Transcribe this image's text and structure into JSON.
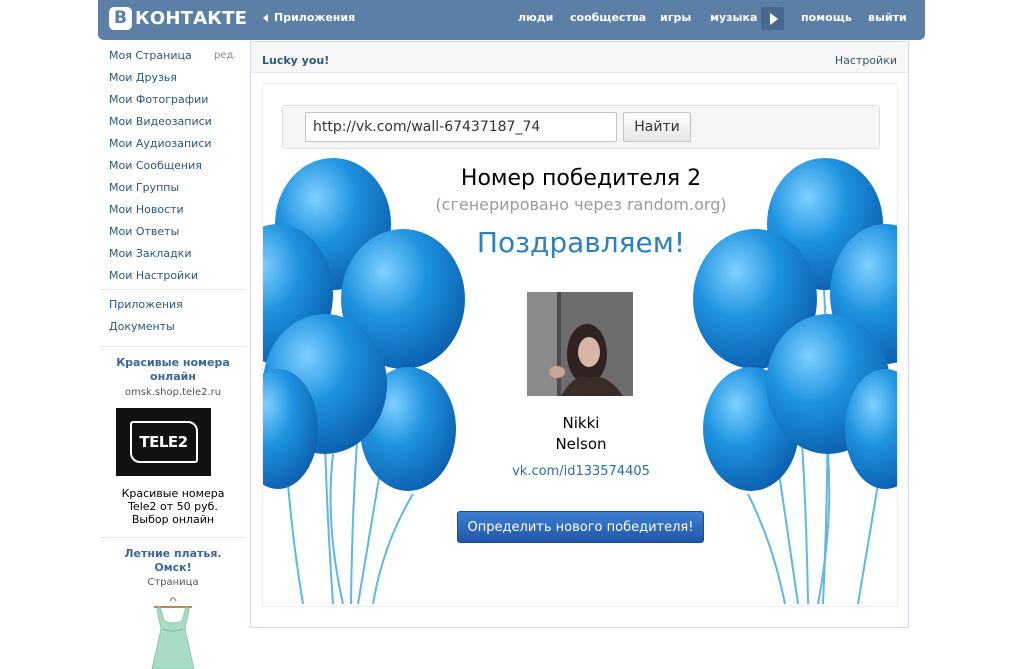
{
  "header": {
    "logo_mark": "В",
    "logo_text": "КОНТАКТЕ",
    "apps_link": "Приложения",
    "nav": [
      "люди",
      "сообщества",
      "игры",
      "музыка",
      "помощь",
      "выйти"
    ]
  },
  "sidebar": {
    "menu": [
      "Моя Страница",
      "Мои Друзья",
      "Мои Фотографии",
      "Мои Видеозаписи",
      "Мои Аудиозаписи",
      "Мои Сообщения",
      "Мои Группы",
      "Мои Новости",
      "Мои Ответы",
      "Мои Закладки",
      "Мои Настройки"
    ],
    "edit_label": "ред.",
    "menu2": [
      "Приложения",
      "Документы"
    ],
    "ad1": {
      "title_line1": "Красивые номера",
      "title_line2": "онлайн",
      "url": "omsk.shop.tele2.ru",
      "logo_text": "TELE2",
      "text_line1": "Красивые номера",
      "text_line2": "Tele2 от 50 руб.",
      "text_line3": "Выбор онлайн"
    },
    "ad2": {
      "title_line1": "Летние платья.",
      "title_line2": "Омск!",
      "subtitle": "Страница"
    }
  },
  "app": {
    "title": "Lucky you!",
    "settings": "Настройки",
    "url_value": "http://vk.com/wall-67437187_74",
    "find_button": "Найти",
    "winner_heading": "Номер победителя 2",
    "generated_note": "(сгенерировано через random.org)",
    "congrats": "Поздравляем!",
    "winner_first_name": "Nikki",
    "winner_last_name": "Nelson",
    "winner_link": "vk.com/id133574405",
    "new_winner_button": "Определить нового победителя!"
  },
  "colors": {
    "header_blue": "#5b7fa6",
    "link_blue": "#2b587a",
    "congrats_blue": "#2a81c2",
    "button_blue": "#2a66bb",
    "balloon_blue": "#1e8fdc"
  },
  "icons": [
    "play-icon",
    "back-arrow-icon"
  ]
}
